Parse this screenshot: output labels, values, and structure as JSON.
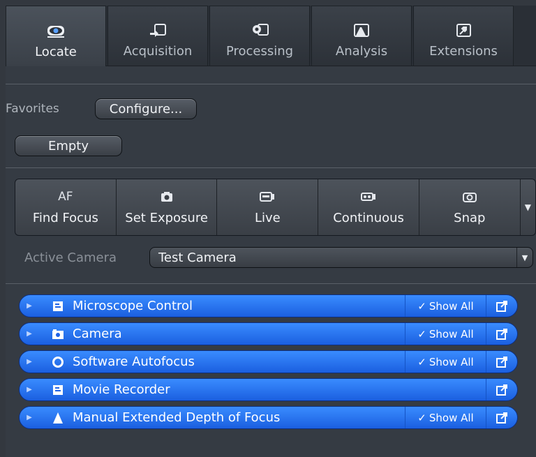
{
  "tabs": [
    {
      "label": "Locate",
      "icon": "eye-icon",
      "active": true
    },
    {
      "label": "Acquisition",
      "icon": "acquisition-icon",
      "active": false
    },
    {
      "label": "Processing",
      "icon": "processing-icon",
      "active": false
    },
    {
      "label": "Analysis",
      "icon": "analysis-icon",
      "active": false
    },
    {
      "label": "Extensions",
      "icon": "extensions-icon",
      "active": false
    }
  ],
  "favorites": {
    "label": "Favorites",
    "configure_label": "Configure...",
    "empty_label": "Empty"
  },
  "toolbar": {
    "buttons": [
      {
        "label": "Find Focus",
        "icon_text": "AF",
        "icon": "autofocus-icon"
      },
      {
        "label": "Set Exposure",
        "icon": "camera-icon"
      },
      {
        "label": "Live",
        "icon": "live-icon"
      },
      {
        "label": "Continuous",
        "icon": "continuous-icon"
      },
      {
        "label": "Snap",
        "icon": "snap-icon"
      }
    ],
    "more_icon": "chevron-down-icon"
  },
  "active_camera": {
    "label": "Active Camera",
    "value": "Test Camera"
  },
  "tool_groups": [
    {
      "name": "Microscope Control",
      "icon": "microscope-control-icon",
      "show_all": "Show All"
    },
    {
      "name": "Camera",
      "icon": "camera-icon",
      "show_all": "Show All"
    },
    {
      "name": "Software Autofocus",
      "icon": "autofocus-circle-icon",
      "show_all": "Show All"
    },
    {
      "name": "Movie Recorder",
      "icon": "movie-recorder-icon",
      "show_all": ""
    },
    {
      "name": "Manual Extended Depth of Focus",
      "icon": "depth-of-focus-icon",
      "show_all": "Show All"
    }
  ],
  "colors": {
    "group_blue": "#2b74f2",
    "background": "#353b43"
  }
}
